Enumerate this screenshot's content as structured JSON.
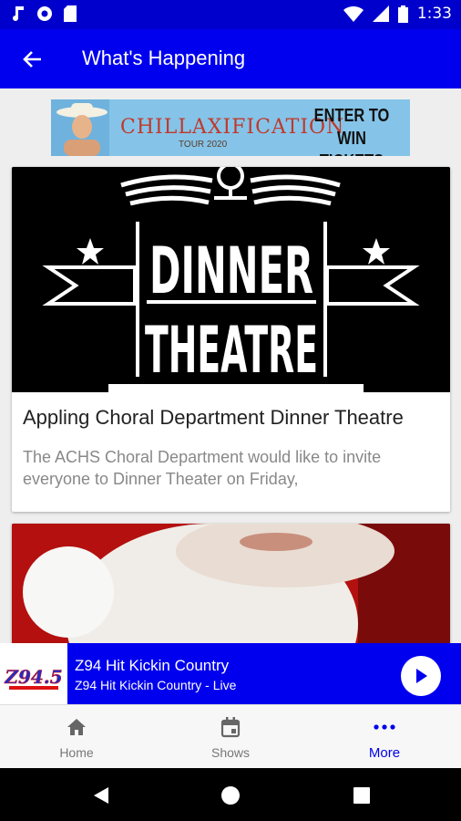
{
  "status_bar": {
    "time": "1:33",
    "icons": [
      "music-note-icon",
      "circle-icon",
      "sd-card-icon",
      "wifi-icon",
      "signal-icon",
      "battery-icon"
    ]
  },
  "app_bar": {
    "title": "What's Happening",
    "back_icon": "arrow-left-icon"
  },
  "banner": {
    "title": "CHILLAXIFICATION",
    "subtitle": "TOUR 2020",
    "cta": "ENTER TO WIN TICKETS"
  },
  "articles": [
    {
      "image_text_line1": "DINNER",
      "image_text_line2": "THEATRE",
      "title": "Appling Choral Department Dinner Theatre",
      "description": "The ACHS Choral Department would like to invite everyone to Dinner Theater on Friday,"
    },
    {
      "image": "santa-claus-photo"
    }
  ],
  "player": {
    "logo_text": "Z94.5",
    "title": "Z94 Hit Kickin Country",
    "subtitle": "Z94 Hit Kickin Country - Live",
    "play_icon": "play-icon"
  },
  "bottom_nav": [
    {
      "label": "Home",
      "icon": "home-icon",
      "active": false
    },
    {
      "label": "Shows",
      "icon": "calendar-icon",
      "active": false
    },
    {
      "label": "More",
      "icon": "more-dots-icon",
      "active": true
    }
  ],
  "colors": {
    "primary": "#0000ee",
    "status_bar": "#0000cc",
    "background": "#eeeeee"
  }
}
